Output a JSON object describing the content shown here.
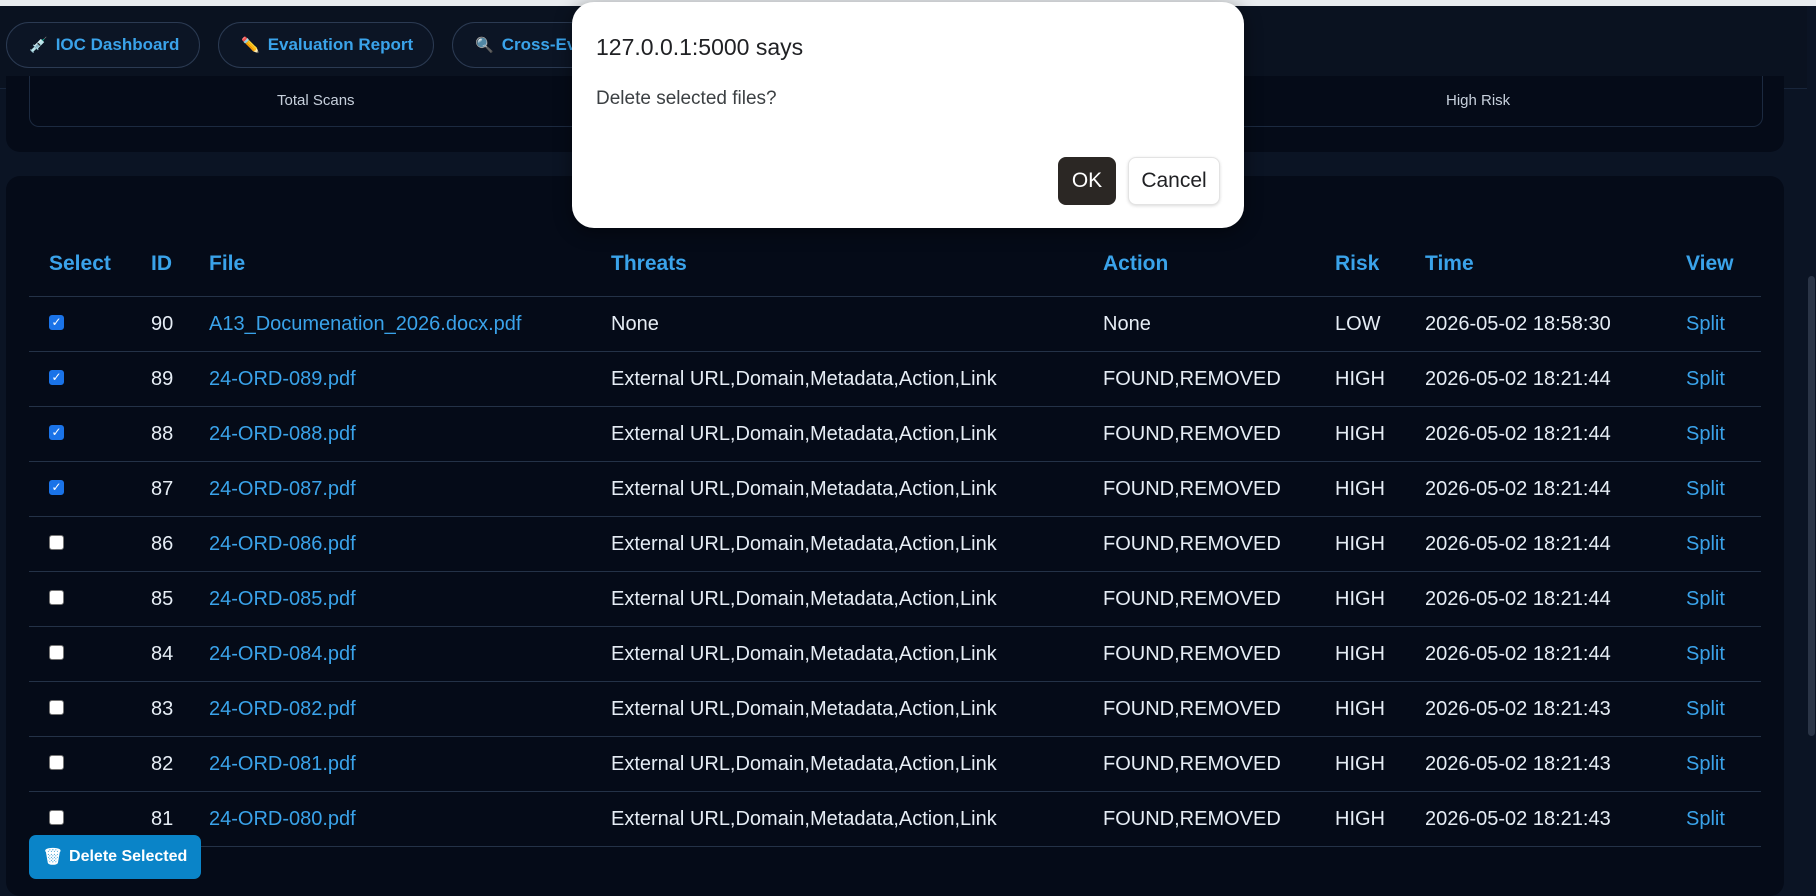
{
  "nav": {
    "ioc_label": "IOC Dashboard",
    "eval_label": "Evaluation Report",
    "cross_label": "Cross-Ev"
  },
  "stats": {
    "total_label": "Total Scans",
    "high_label": "High Risk"
  },
  "table": {
    "headers": [
      "Select",
      "ID",
      "File",
      "Threats",
      "Action",
      "Risk",
      "Time",
      "View"
    ],
    "rows": [
      {
        "checked": true,
        "id": "90",
        "file": "A13_Documenation_2026.docx.pdf",
        "threats": "None",
        "action": "None",
        "risk": "LOW",
        "time": "2026-05-02 18:58:30",
        "view": "Split"
      },
      {
        "checked": true,
        "id": "89",
        "file": "24-ORD-089.pdf",
        "threats": "External URL,Domain,Metadata,Action,Link",
        "action": "FOUND,REMOVED",
        "risk": "HIGH",
        "time": "2026-05-02 18:21:44",
        "view": "Split"
      },
      {
        "checked": true,
        "id": "88",
        "file": "24-ORD-088.pdf",
        "threats": "External URL,Domain,Metadata,Action,Link",
        "action": "FOUND,REMOVED",
        "risk": "HIGH",
        "time": "2026-05-02 18:21:44",
        "view": "Split"
      },
      {
        "checked": true,
        "id": "87",
        "file": "24-ORD-087.pdf",
        "threats": "External URL,Domain,Metadata,Action,Link",
        "action": "FOUND,REMOVED",
        "risk": "HIGH",
        "time": "2026-05-02 18:21:44",
        "view": "Split"
      },
      {
        "checked": false,
        "id": "86",
        "file": "24-ORD-086.pdf",
        "threats": "External URL,Domain,Metadata,Action,Link",
        "action": "FOUND,REMOVED",
        "risk": "HIGH",
        "time": "2026-05-02 18:21:44",
        "view": "Split"
      },
      {
        "checked": false,
        "id": "85",
        "file": "24-ORD-085.pdf",
        "threats": "External URL,Domain,Metadata,Action,Link",
        "action": "FOUND,REMOVED",
        "risk": "HIGH",
        "time": "2026-05-02 18:21:44",
        "view": "Split"
      },
      {
        "checked": false,
        "id": "84",
        "file": "24-ORD-084.pdf",
        "threats": "External URL,Domain,Metadata,Action,Link",
        "action": "FOUND,REMOVED",
        "risk": "HIGH",
        "time": "2026-05-02 18:21:44",
        "view": "Split"
      },
      {
        "checked": false,
        "id": "83",
        "file": "24-ORD-082.pdf",
        "threats": "External URL,Domain,Metadata,Action,Link",
        "action": "FOUND,REMOVED",
        "risk": "HIGH",
        "time": "2026-05-02 18:21:43",
        "view": "Split"
      },
      {
        "checked": false,
        "id": "82",
        "file": "24-ORD-081.pdf",
        "threats": "External URL,Domain,Metadata,Action,Link",
        "action": "FOUND,REMOVED",
        "risk": "HIGH",
        "time": "2026-05-02 18:21:43",
        "view": "Split"
      },
      {
        "checked": false,
        "id": "81",
        "file": "24-ORD-080.pdf",
        "threats": "External URL,Domain,Metadata,Action,Link",
        "action": "FOUND,REMOVED",
        "risk": "HIGH",
        "time": "2026-05-02 18:21:43",
        "view": "Split"
      }
    ]
  },
  "delete_button": {
    "label": "Delete Selected",
    "icon": "trash-icon"
  },
  "dialog": {
    "title": "127.0.0.1:5000 says",
    "message": "Delete selected files?",
    "ok": "OK",
    "cancel": "Cancel"
  },
  "colors": {
    "accent": "#3aa3ea",
    "background": "#050b18",
    "button": "#0a84c8"
  }
}
